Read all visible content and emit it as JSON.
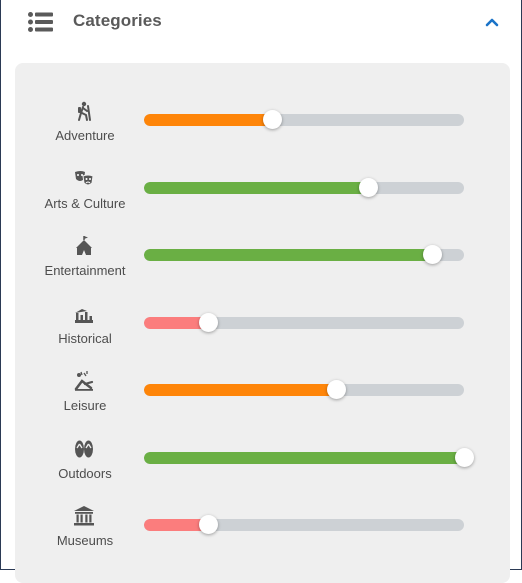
{
  "header": {
    "menu_icon": "list-icon",
    "title": "Categories",
    "toggle_icon": "chevron-up-icon",
    "accent_color": "#1a73c8"
  },
  "colors": {
    "track": "#cdd1d5",
    "orange": "#fe8509",
    "green": "#6aaf44",
    "red": "#fb7d7d",
    "panel_bg": "#efefef"
  },
  "categories": [
    {
      "label": "Adventure",
      "icon": "hiker-icon",
      "level": 0.4,
      "color": "#fe8509"
    },
    {
      "label": "Arts & Culture",
      "icon": "theater-masks-icon",
      "level": 0.7,
      "color": "#6aaf44"
    },
    {
      "label": "Entertainment",
      "icon": "circus-tent-icon",
      "level": 0.9,
      "color": "#6aaf44"
    },
    {
      "label": "Historical",
      "icon": "ruins-icon",
      "level": 0.2,
      "color": "#fb7d7d"
    },
    {
      "label": "Leisure",
      "icon": "beach-chair-icon",
      "level": 0.6,
      "color": "#fe8509"
    },
    {
      "label": "Outdoors",
      "icon": "flip-flops-icon",
      "level": 1.0,
      "color": "#6aaf44"
    },
    {
      "label": "Museums",
      "icon": "museum-icon",
      "level": 0.2,
      "color": "#fb7d7d"
    }
  ]
}
